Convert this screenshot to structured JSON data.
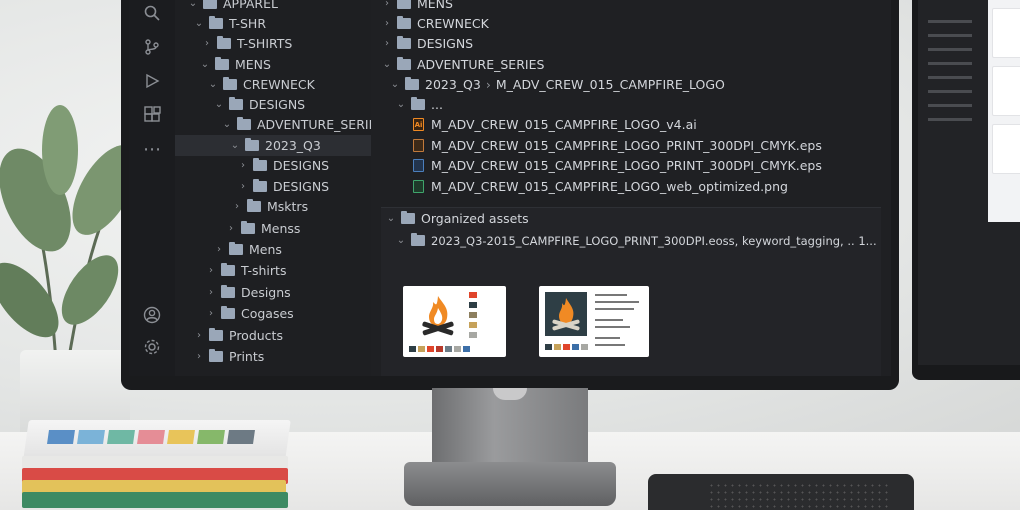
{
  "sidebar_tree": [
    {
      "label": "APPAREL",
      "expanded": true
    },
    {
      "label": "T-SHR",
      "expanded": true
    },
    {
      "label": "T-SHIRTS",
      "expanded": false
    },
    {
      "label": "MENS",
      "expanded": true
    },
    {
      "label": "CREWNECK",
      "expanded": true
    },
    {
      "label": "DESIGNS",
      "expanded": true
    },
    {
      "label": "ADVENTURE_SERIES",
      "expanded": true
    },
    {
      "label": "2023_Q3",
      "expanded": true,
      "selected": true
    },
    {
      "label": "DESIGNS",
      "expanded": false
    },
    {
      "label": "DESIGNS",
      "expanded": false
    },
    {
      "label": "Msktrs",
      "expanded": false
    },
    {
      "label": "Menss",
      "expanded": false
    },
    {
      "label": "Mens",
      "expanded": false
    },
    {
      "label": "T-shirts",
      "expanded": false
    },
    {
      "label": "Designs",
      "expanded": false
    },
    {
      "label": "Cogases",
      "expanded": false
    },
    {
      "label": "Products",
      "expanded": false
    },
    {
      "label": "Prints",
      "expanded": false
    }
  ],
  "main": {
    "folders": [
      "MENS",
      "CREWNECK",
      "DESIGNS",
      "ADVENTURE_SERIES"
    ],
    "breadcrumb": [
      "2023_Q3",
      "M_ADV_CREW_015_CAMPFIRE_LOGO"
    ],
    "ellipsis_label": "...",
    "files": [
      {
        "name": "M_ADV_CREW_015_CAMPFIRE_LOGO_v4.ai",
        "type": "ai",
        "icon": "illustrator-file-icon"
      },
      {
        "name": "M_ADV_CREW_015_CAMPFIRE_LOGO_PRINT_300DPI_CMYK.eps",
        "type": "eps",
        "icon": "eps-file-icon"
      },
      {
        "name": "M_ADV_CREW_015_CAMPFIRE_LOGO_PRINT_300DPI_CMYK.eps",
        "type": "eps2",
        "icon": "eps-file-icon"
      },
      {
        "name": "M_ADV_CREW_015_CAMPFIRE_LOGO_web_optimized.png",
        "type": "png",
        "icon": "png-file-icon"
      }
    ],
    "organized_assets_label": "Organized assets",
    "organized_assets_item": "2023_Q3-2015_CAMPFIRE_LOGO_PRINT_300DPI.eoss, keyword_tagging, .. 1..."
  },
  "activity_icons": [
    "search-icon",
    "source-control-icon",
    "run-debug-icon",
    "extensions-icon",
    "more-icon",
    "account-icon",
    "settings-icon"
  ],
  "colors": {
    "screen_bg": "#1e1f22",
    "text": "#c9ccd1",
    "folder": "#9aa7b8",
    "selection": "#2c2e33",
    "flame_orange": "#f08a24",
    "brand_palette": [
      "#e0452b",
      "#b73a2b",
      "#2e3e45",
      "#8d7f5f",
      "#c6a25a",
      "#a7a8a3"
    ]
  }
}
